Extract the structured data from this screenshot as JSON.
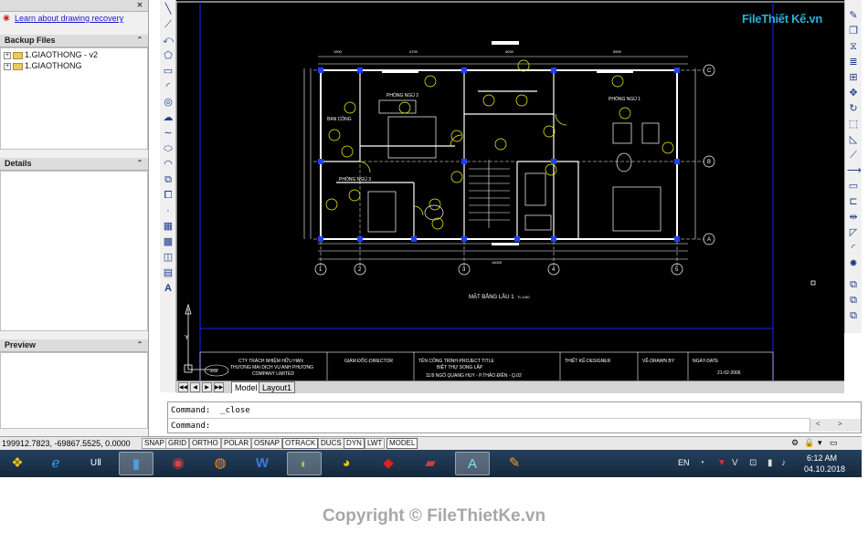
{
  "left_panel": {
    "recovery_link": "Learn about drawing recovery",
    "backup_files_title": "Backup Files",
    "files": [
      "1.GIAOTHONG - v2",
      "1.GIAOTHONG"
    ],
    "details_title": "Details",
    "preview_title": "Preview"
  },
  "tabs": [
    "Model",
    "Layout1"
  ],
  "command": {
    "history": "Command:  _close",
    "prompt": "Command:"
  },
  "status": {
    "coords": "199912.7823, -69867.5525, 0.0000",
    "buttons": [
      "SNAP",
      "GRID",
      "ORTHO",
      "POLAR",
      "OSNAP",
      "OTRACK",
      "DUCS",
      "DYN",
      "LWT",
      "MODEL"
    ]
  },
  "brand": {
    "name": "File",
    "name2": "Thiết Kế",
    "domain": ".vn"
  },
  "drawing": {
    "plan_title": "MẶT BẰNG LẦU 1",
    "scale": "TL:1/50",
    "rooms": [
      "PHÒNG NGỦ 2",
      "BAN CÔNG",
      "PHÒNG NGỦ 3",
      "PHÒNG NGỦ 1"
    ],
    "grid_letters": [
      "C",
      "B",
      "A"
    ],
    "grid_numbers": [
      "1",
      "2",
      "3",
      "4",
      "5"
    ],
    "dim_total": "16000",
    "dim_segments": [
      "1900",
      "4700",
      "4000",
      "5500"
    ],
    "title_block": {
      "company": "CTY TRÁCH NHIỆM HỮU HẠN",
      "company2": "THƯƠNG MẠI DỊCH VỤ ANH PHƯƠNG",
      "company3": "COMPANY LIMITED",
      "director": "GIÁM ĐỐC-DIRECTOR",
      "project_label": "TÊN CÔNG TRÌNH-PROJECT TITLE",
      "project_name": "BIỆT THỰ SONG LẬP",
      "address": "11/9 NGÔ QUANG HUY - P.THẢO ĐIỀN - Q.02",
      "designer": "THIẾT KẾ-DESIGNER",
      "drawn_by": "VẼ-DRAWN BY",
      "date_label": "NGÀY-DATE",
      "date": "21-02-2006",
      "logo_text": "AHA"
    }
  },
  "taskbar": {
    "lang": "EN",
    "time": "6:12 AM",
    "date": "04.10.2018",
    "apps": [
      "start-orb",
      "internet-explorer",
      "unikey",
      "file-manager",
      "media-player",
      "firefox",
      "word",
      "coccoc",
      "chrome",
      "game",
      "archive",
      "autocad",
      "paint"
    ]
  },
  "footer": {
    "copyright": "Copyright © FileThietKe.vn"
  }
}
